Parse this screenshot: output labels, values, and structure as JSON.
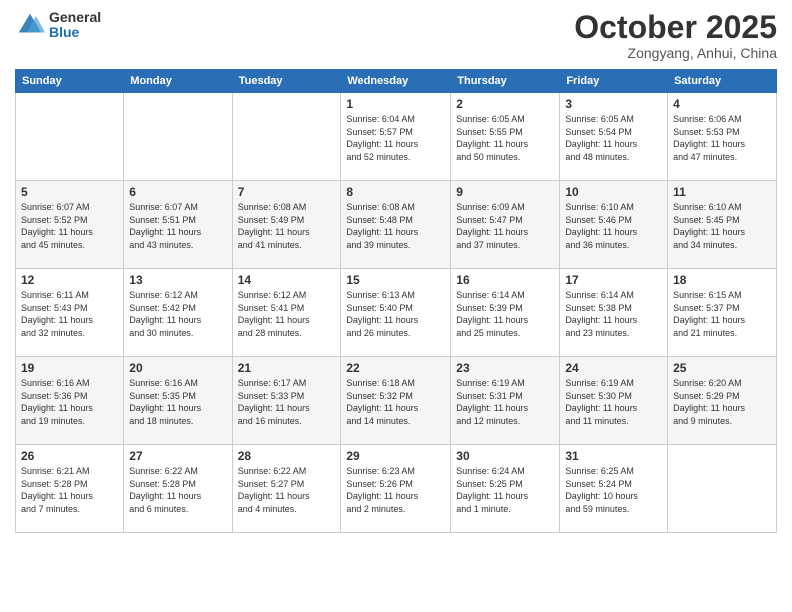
{
  "header": {
    "logo_general": "General",
    "logo_blue": "Blue",
    "month": "October 2025",
    "location": "Zongyang, Anhui, China"
  },
  "days_of_week": [
    "Sunday",
    "Monday",
    "Tuesday",
    "Wednesday",
    "Thursday",
    "Friday",
    "Saturday"
  ],
  "weeks": [
    [
      {
        "day": "",
        "info": ""
      },
      {
        "day": "",
        "info": ""
      },
      {
        "day": "",
        "info": ""
      },
      {
        "day": "1",
        "info": "Sunrise: 6:04 AM\nSunset: 5:57 PM\nDaylight: 11 hours\nand 52 minutes."
      },
      {
        "day": "2",
        "info": "Sunrise: 6:05 AM\nSunset: 5:55 PM\nDaylight: 11 hours\nand 50 minutes."
      },
      {
        "day": "3",
        "info": "Sunrise: 6:05 AM\nSunset: 5:54 PM\nDaylight: 11 hours\nand 48 minutes."
      },
      {
        "day": "4",
        "info": "Sunrise: 6:06 AM\nSunset: 5:53 PM\nDaylight: 11 hours\nand 47 minutes."
      }
    ],
    [
      {
        "day": "5",
        "info": "Sunrise: 6:07 AM\nSunset: 5:52 PM\nDaylight: 11 hours\nand 45 minutes."
      },
      {
        "day": "6",
        "info": "Sunrise: 6:07 AM\nSunset: 5:51 PM\nDaylight: 11 hours\nand 43 minutes."
      },
      {
        "day": "7",
        "info": "Sunrise: 6:08 AM\nSunset: 5:49 PM\nDaylight: 11 hours\nand 41 minutes."
      },
      {
        "day": "8",
        "info": "Sunrise: 6:08 AM\nSunset: 5:48 PM\nDaylight: 11 hours\nand 39 minutes."
      },
      {
        "day": "9",
        "info": "Sunrise: 6:09 AM\nSunset: 5:47 PM\nDaylight: 11 hours\nand 37 minutes."
      },
      {
        "day": "10",
        "info": "Sunrise: 6:10 AM\nSunset: 5:46 PM\nDaylight: 11 hours\nand 36 minutes."
      },
      {
        "day": "11",
        "info": "Sunrise: 6:10 AM\nSunset: 5:45 PM\nDaylight: 11 hours\nand 34 minutes."
      }
    ],
    [
      {
        "day": "12",
        "info": "Sunrise: 6:11 AM\nSunset: 5:43 PM\nDaylight: 11 hours\nand 32 minutes."
      },
      {
        "day": "13",
        "info": "Sunrise: 6:12 AM\nSunset: 5:42 PM\nDaylight: 11 hours\nand 30 minutes."
      },
      {
        "day": "14",
        "info": "Sunrise: 6:12 AM\nSunset: 5:41 PM\nDaylight: 11 hours\nand 28 minutes."
      },
      {
        "day": "15",
        "info": "Sunrise: 6:13 AM\nSunset: 5:40 PM\nDaylight: 11 hours\nand 26 minutes."
      },
      {
        "day": "16",
        "info": "Sunrise: 6:14 AM\nSunset: 5:39 PM\nDaylight: 11 hours\nand 25 minutes."
      },
      {
        "day": "17",
        "info": "Sunrise: 6:14 AM\nSunset: 5:38 PM\nDaylight: 11 hours\nand 23 minutes."
      },
      {
        "day": "18",
        "info": "Sunrise: 6:15 AM\nSunset: 5:37 PM\nDaylight: 11 hours\nand 21 minutes."
      }
    ],
    [
      {
        "day": "19",
        "info": "Sunrise: 6:16 AM\nSunset: 5:36 PM\nDaylight: 11 hours\nand 19 minutes."
      },
      {
        "day": "20",
        "info": "Sunrise: 6:16 AM\nSunset: 5:35 PM\nDaylight: 11 hours\nand 18 minutes."
      },
      {
        "day": "21",
        "info": "Sunrise: 6:17 AM\nSunset: 5:33 PM\nDaylight: 11 hours\nand 16 minutes."
      },
      {
        "day": "22",
        "info": "Sunrise: 6:18 AM\nSunset: 5:32 PM\nDaylight: 11 hours\nand 14 minutes."
      },
      {
        "day": "23",
        "info": "Sunrise: 6:19 AM\nSunset: 5:31 PM\nDaylight: 11 hours\nand 12 minutes."
      },
      {
        "day": "24",
        "info": "Sunrise: 6:19 AM\nSunset: 5:30 PM\nDaylight: 11 hours\nand 11 minutes."
      },
      {
        "day": "25",
        "info": "Sunrise: 6:20 AM\nSunset: 5:29 PM\nDaylight: 11 hours\nand 9 minutes."
      }
    ],
    [
      {
        "day": "26",
        "info": "Sunrise: 6:21 AM\nSunset: 5:28 PM\nDaylight: 11 hours\nand 7 minutes."
      },
      {
        "day": "27",
        "info": "Sunrise: 6:22 AM\nSunset: 5:28 PM\nDaylight: 11 hours\nand 6 minutes."
      },
      {
        "day": "28",
        "info": "Sunrise: 6:22 AM\nSunset: 5:27 PM\nDaylight: 11 hours\nand 4 minutes."
      },
      {
        "day": "29",
        "info": "Sunrise: 6:23 AM\nSunset: 5:26 PM\nDaylight: 11 hours\nand 2 minutes."
      },
      {
        "day": "30",
        "info": "Sunrise: 6:24 AM\nSunset: 5:25 PM\nDaylight: 11 hours\nand 1 minute."
      },
      {
        "day": "31",
        "info": "Sunrise: 6:25 AM\nSunset: 5:24 PM\nDaylight: 10 hours\nand 59 minutes."
      },
      {
        "day": "",
        "info": ""
      }
    ]
  ]
}
